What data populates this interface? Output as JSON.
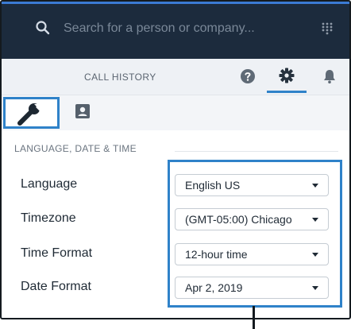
{
  "search": {
    "placeholder": "Search for a person or company..."
  },
  "tabs": {
    "call_history": "CALL HISTORY"
  },
  "icons": {
    "search": "search-icon",
    "apps": "grid-icon",
    "help": "help-icon",
    "settings": "gear-icon",
    "notifications": "bell-icon",
    "general_settings": "wrench-icon",
    "contact_settings": "contact-card-icon"
  },
  "section": {
    "title": "LANGUAGE, DATE & TIME"
  },
  "settings": [
    {
      "label": "Language",
      "value": "English US"
    },
    {
      "label": "Timezone",
      "value": "(GMT-05:00) Chicago"
    },
    {
      "label": "Time Format",
      "value": "12-hour time"
    },
    {
      "label": "Date Format",
      "value": "Apr 2, 2019"
    }
  ],
  "colors": {
    "header_bg": "#1c2b3d",
    "accent": "#2f82c9",
    "tabs_bg": "#eef1f5",
    "frame": "#141a1f"
  }
}
